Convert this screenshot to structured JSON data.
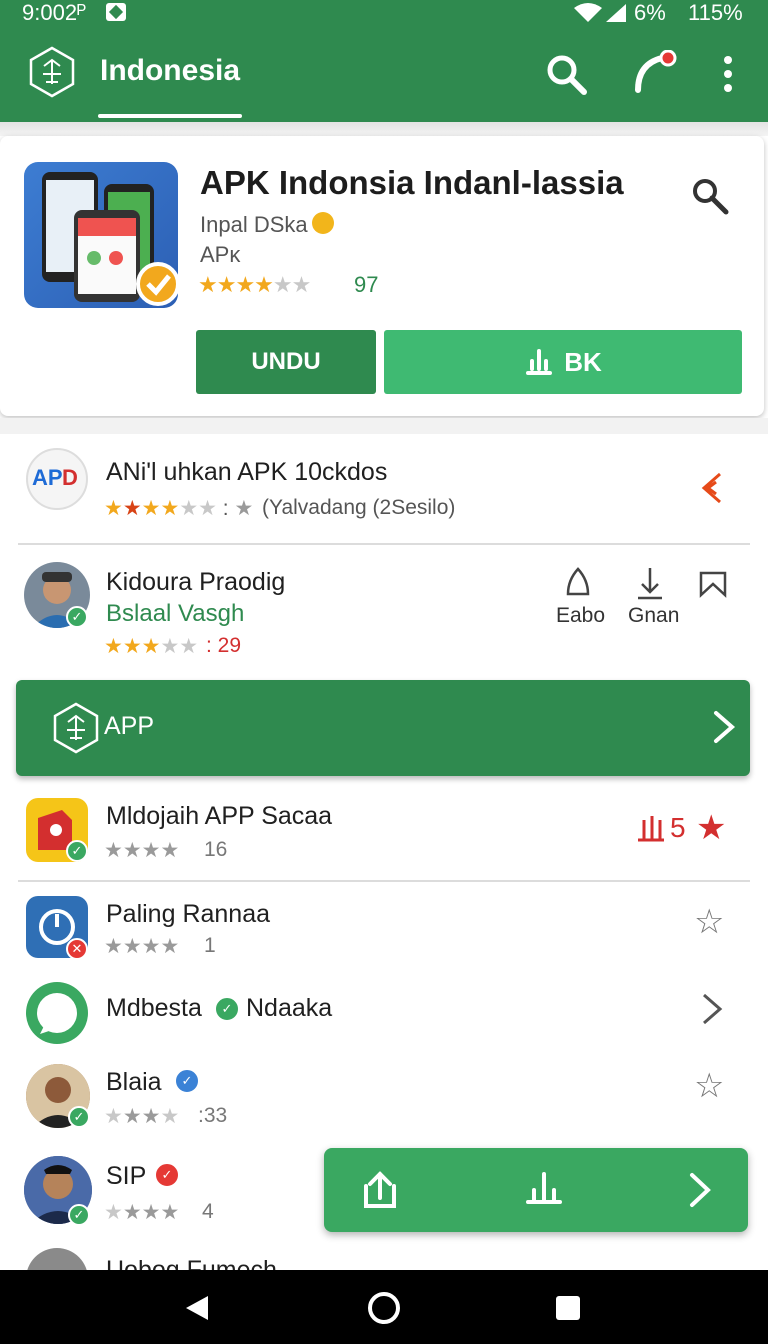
{
  "status": {
    "time": "9:002ᴾ",
    "signal": "6%",
    "battery": "115%"
  },
  "appbar": {
    "title": "Indonesia"
  },
  "featured": {
    "name": "APK Indonsia Indanl-lassia",
    "developer": "Inpal DSka",
    "type": "APĸ",
    "stars": "★★★★★",
    "rating_count": "97",
    "btn_undu": "UNDU",
    "btn_bk": "BK"
  },
  "list": [
    {
      "title": "ANi'l uhkan APK 10ckdos",
      "sub": "(Yalvadang (2Sesilo)"
    },
    {
      "title": "Kidoura Praodig",
      "sub": "Bslaal Vasgh",
      "rating": ": 29",
      "actions": [
        "Eabo",
        "Gnan"
      ]
    },
    {
      "title": "Mldojaih APP Sacaa",
      "rating": "16",
      "count": "5"
    },
    {
      "title": "Paling Rannaa",
      "rating": "1"
    },
    {
      "title": "Mdbesta",
      "title2": "Ndaaka"
    },
    {
      "title": "Blaia",
      "rating": ":33"
    },
    {
      "title": "SIP",
      "rating": "4"
    },
    {
      "title": "Uobog Fumech"
    }
  ],
  "banner": {
    "label": "APP"
  },
  "colors": {
    "primary": "#2f8a4f",
    "accent": "#3fba72",
    "star": "#f2a81d",
    "alert": "#d32f2f"
  }
}
